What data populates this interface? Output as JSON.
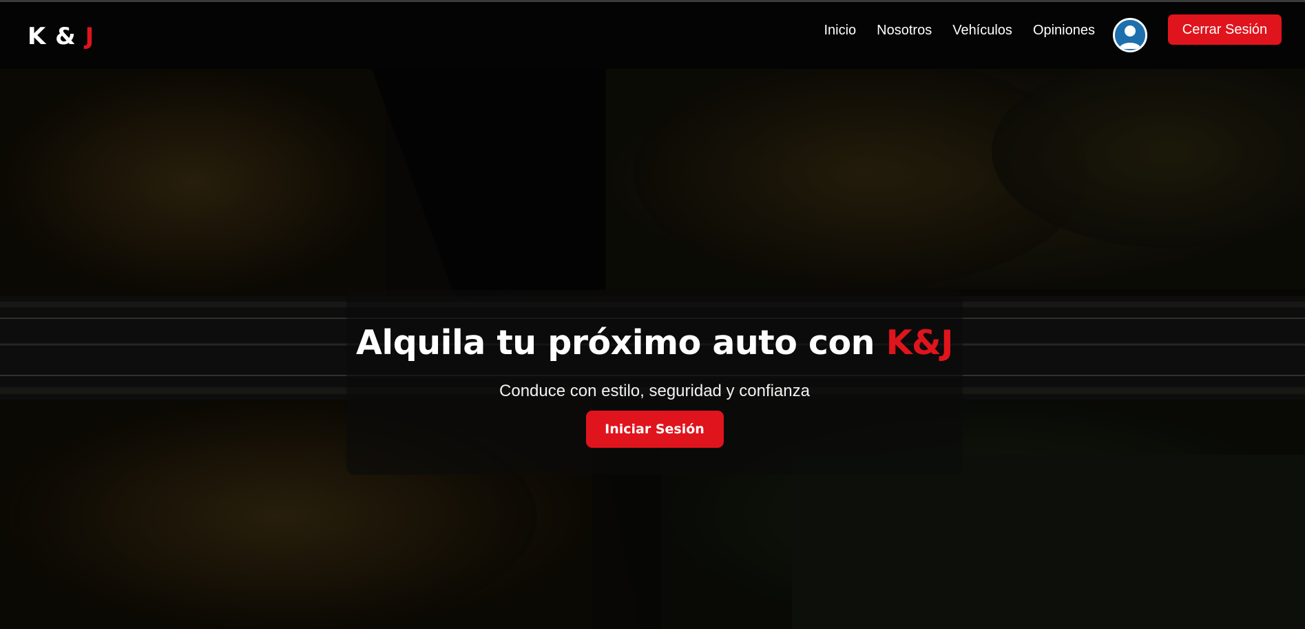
{
  "brand": {
    "logo_left": "K & ",
    "logo_right": "J"
  },
  "nav": {
    "items": [
      {
        "label": "Inicio"
      },
      {
        "label": "Nosotros"
      },
      {
        "label": "Vehículos"
      },
      {
        "label": "Opiniones"
      }
    ],
    "avatar_icon": "user-avatar-icon",
    "logout_label": "Cerrar Sesión"
  },
  "hero": {
    "title_main": "Alquila tu próximo auto con ",
    "title_brand": "K&J",
    "subtitle": "Conduce con estilo, seguridad y confianza",
    "cta_label": "Iniciar Sesión"
  },
  "colors": {
    "accent": "#e0141c",
    "navbar": "#040404",
    "text": "#ffffff"
  }
}
